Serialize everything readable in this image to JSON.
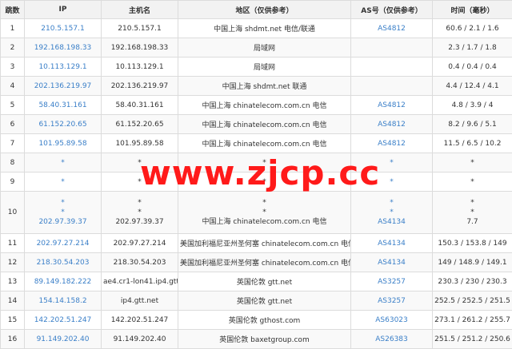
{
  "headers": [
    "跳数",
    "IP",
    "主机名",
    "地区（仅供参考）",
    "AS号（仅供参考）",
    "时间（毫秒）"
  ],
  "rows": [
    {
      "hop": "1",
      "ip": [
        "210.5.157.1"
      ],
      "host": [
        "210.5.157.1"
      ],
      "region": [
        "中国上海 shdmt.net 电信/联通"
      ],
      "asn": [
        "AS4812"
      ],
      "time": [
        "60.6 / 2.1 / 1.6"
      ]
    },
    {
      "hop": "2",
      "ip": [
        "192.168.198.33"
      ],
      "host": [
        "192.168.198.33"
      ],
      "region": [
        "局域网"
      ],
      "asn": [
        ""
      ],
      "time": [
        "2.3 / 1.7 / 1.8"
      ]
    },
    {
      "hop": "3",
      "ip": [
        "10.113.129.1"
      ],
      "host": [
        "10.113.129.1"
      ],
      "region": [
        "局域网"
      ],
      "asn": [
        ""
      ],
      "time": [
        "0.4 / 0.4 / 0.4"
      ]
    },
    {
      "hop": "4",
      "ip": [
        "202.136.219.97"
      ],
      "host": [
        "202.136.219.97"
      ],
      "region": [
        "中国上海 shdmt.net 联通"
      ],
      "asn": [
        ""
      ],
      "time": [
        "4.4 / 12.4 / 4.1"
      ]
    },
    {
      "hop": "5",
      "ip": [
        "58.40.31.161"
      ],
      "host": [
        "58.40.31.161"
      ],
      "region": [
        "中国上海 chinatelecom.com.cn 电信"
      ],
      "asn": [
        "AS4812"
      ],
      "time": [
        "4.8 / 3.9 / 4"
      ]
    },
    {
      "hop": "6",
      "ip": [
        "61.152.20.65"
      ],
      "host": [
        "61.152.20.65"
      ],
      "region": [
        "中国上海 chinatelecom.com.cn 电信"
      ],
      "asn": [
        "AS4812"
      ],
      "time": [
        "8.2 / 9.6 / 5.1"
      ]
    },
    {
      "hop": "7",
      "ip": [
        "101.95.89.58"
      ],
      "host": [
        "101.95.89.58"
      ],
      "region": [
        "中国上海 chinatelecom.com.cn 电信"
      ],
      "asn": [
        "AS4812"
      ],
      "time": [
        "11.5 / 6.5 / 10.2"
      ]
    },
    {
      "hop": "8",
      "ip": [
        "*"
      ],
      "host": [
        "*"
      ],
      "region": [
        "*"
      ],
      "asn": [
        "*"
      ],
      "time": [
        "*"
      ]
    },
    {
      "hop": "9",
      "ip": [
        "*"
      ],
      "host": [
        "*"
      ],
      "region": [
        "*"
      ],
      "asn": [
        "*"
      ],
      "time": [
        "*"
      ]
    },
    {
      "hop": "10",
      "ip": [
        "*",
        "*",
        "202.97.39.37"
      ],
      "host": [
        "*",
        "*",
        "202.97.39.37"
      ],
      "region": [
        "*",
        "*",
        "中国上海 chinatelecom.com.cn 电信"
      ],
      "asn": [
        "*",
        "*",
        "AS4134"
      ],
      "time": [
        "*",
        "*",
        "7.7"
      ]
    },
    {
      "hop": "11",
      "ip": [
        "202.97.27.214"
      ],
      "host": [
        "202.97.27.214"
      ],
      "region": [
        "美国加利福尼亚州圣何塞 chinatelecom.com.cn 电信"
      ],
      "asn": [
        "AS4134"
      ],
      "time": [
        "150.3 / 153.8 / 149"
      ]
    },
    {
      "hop": "12",
      "ip": [
        "218.30.54.203"
      ],
      "host": [
        "218.30.54.203"
      ],
      "region": [
        "美国加利福尼亚州圣何塞 chinatelecom.com.cn 电信"
      ],
      "asn": [
        "AS4134"
      ],
      "time": [
        "149 / 148.9 / 149.1"
      ]
    },
    {
      "hop": "13",
      "ip": [
        "89.149.182.222"
      ],
      "host": [
        "ae4.cr1-lon41.ip4.gtt.net"
      ],
      "region": [
        "英国伦敦 gtt.net"
      ],
      "asn": [
        "AS3257"
      ],
      "time": [
        "230.3 / 230 / 230.3"
      ]
    },
    {
      "hop": "14",
      "ip": [
        "154.14.158.2"
      ],
      "host": [
        "ip4.gtt.net"
      ],
      "region": [
        "英国伦敦 gtt.net"
      ],
      "asn": [
        "AS3257"
      ],
      "time": [
        "252.5 / 252.5 / 251.5"
      ]
    },
    {
      "hop": "15",
      "ip": [
        "142.202.51.247"
      ],
      "host": [
        "142.202.51.247"
      ],
      "region": [
        "英国伦敦 gthost.com"
      ],
      "asn": [
        "AS63023"
      ],
      "time": [
        "273.1 / 261.2 / 255.7"
      ]
    },
    {
      "hop": "16",
      "ip": [
        "91.149.202.40"
      ],
      "host": [
        "91.149.202.40"
      ],
      "region": [
        "英国伦敦 baxetgroup.com"
      ],
      "asn": [
        "AS26383"
      ],
      "time": [
        "251.5 / 251.2 / 250.6"
      ]
    }
  ],
  "watermark": "www.zjcp.cc"
}
